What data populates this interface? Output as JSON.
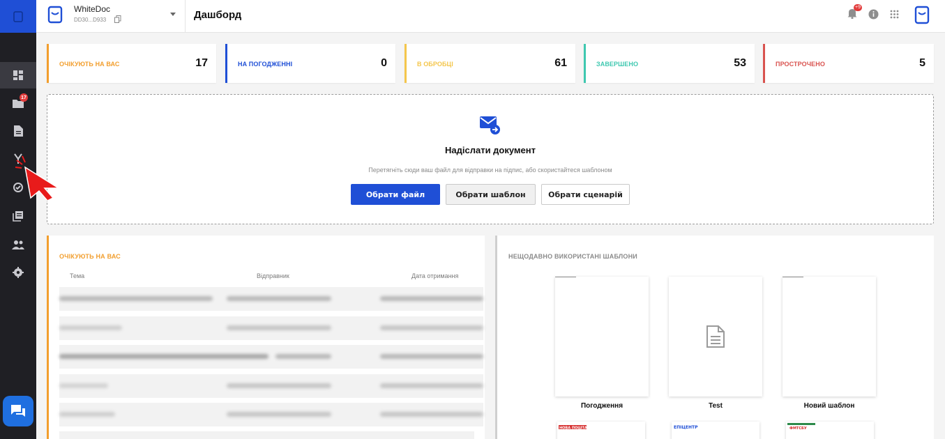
{
  "app": {
    "org_name": "WhiteDoc",
    "org_code": "DD30...D933",
    "page_title": "Дашборд",
    "notification_count": "+9"
  },
  "sidebar": {
    "badge_count": "17",
    "items": [
      {
        "icon": "dashboard-icon"
      },
      {
        "icon": "folder-icon"
      },
      {
        "icon": "document-icon"
      },
      {
        "icon": "route-icon"
      },
      {
        "icon": "sync-check-icon"
      },
      {
        "icon": "library-icon"
      },
      {
        "icon": "users-icon"
      },
      {
        "icon": "settings-icon"
      }
    ]
  },
  "stats": [
    {
      "label": "ОЧІКУЮТЬ НА ВАС",
      "value": "17",
      "color": "#f29e2d"
    },
    {
      "label": "НА ПОГОДЖЕННІ",
      "value": "0",
      "color": "#1f4fd6"
    },
    {
      "label": "В ОБРОБЦІ",
      "value": "61",
      "color": "#f4c64c"
    },
    {
      "label": "ЗАВЕРШЕНО",
      "value": "53",
      "color": "#3fc8b0"
    },
    {
      "label": "ПРОСТРОЧЕНО",
      "value": "5",
      "color": "#d9534f"
    }
  ],
  "upload": {
    "title": "Надіслати документ",
    "hint": "Перетягніть сюди ваш файл для відправки на підпис, або скористайтеся шаблоном",
    "btn_file": "Обрати файл",
    "btn_template": "Обрати шаблон",
    "btn_scenario": "Обрати сценарій"
  },
  "awaiting": {
    "title": "ОЧІКУЮТЬ НА ВАС",
    "columns": [
      "Тема",
      "Відправник",
      "Дата отримання"
    ]
  },
  "templates": {
    "title": "НЕЩОДАВНО ВИКОРИСТАНІ ШАБЛОНИ",
    "items": [
      {
        "name": "Погодження"
      },
      {
        "name": "Test"
      },
      {
        "name": "Новий шаблон"
      }
    ],
    "logos": [
      "НОВА ПОШТА",
      "ЕПІЦЕНТР",
      "ФМТСБУ"
    ]
  },
  "colors": {
    "accent": "#1f4fd6",
    "sidebar_bg": "#1f1f24",
    "awaiting": "#f29e2d"
  }
}
